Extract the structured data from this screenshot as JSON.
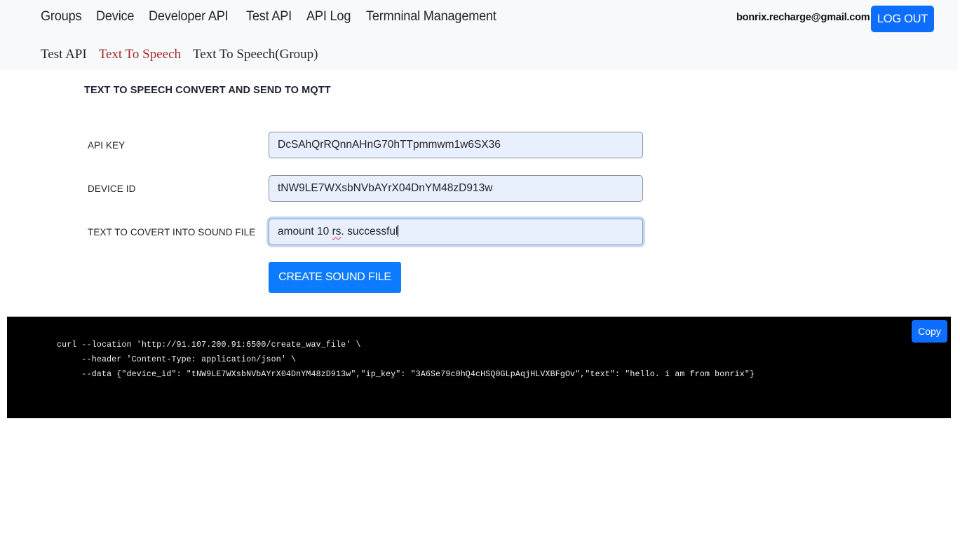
{
  "nav": {
    "main_items": [
      {
        "label": "Groups"
      },
      {
        "label": "Device"
      },
      {
        "label": "Developer API"
      },
      {
        "label": "Test API"
      },
      {
        "label": "API Log"
      },
      {
        "label": "Termninal Management"
      }
    ],
    "sub_items": [
      {
        "label": "Test API",
        "active": false
      },
      {
        "label": "Text To Speech",
        "active": true
      },
      {
        "label": "Text To Speech(Group)",
        "active": false
      }
    ],
    "user_email": "bonrix.recharge@gmail.com",
    "logout_label": "LOG OUT"
  },
  "page": {
    "title": "TEXT TO SPEECH CONVERT AND SEND TO MQTT"
  },
  "form": {
    "api_key": {
      "label": "API KEY",
      "value": "DcSAhQrRQnnAHnG70hTTpmmwm1w6SX36"
    },
    "device_id": {
      "label": "DEVICE ID",
      "value": "tNW9LE7WXsbNVbAYrX04DnYM48zD913w"
    },
    "text": {
      "label": "TEXT TO COVERT INTO SOUND FILE",
      "value_before": "amount 10 ",
      "value_misspelled": "rs",
      "value_after": ". successful"
    },
    "submit_label": "CREATE SOUND FILE"
  },
  "code": {
    "lines": [
      "curl --location 'http://91.107.200.91:6500/create_wav_file' \\",
      "     --header 'Content-Type: application/json' \\",
      "     --data {\"device_id\": \"tNW9LE7WXsbNVbAYrX04DnYM48zD913w\",\"ip_key\": \"3A6Se79c0hQ4cHSQ0GLpAqjHLVXBFgOv\",\"text\": \"hello. i am from bonrix\"}"
    ],
    "copy_label": "Copy"
  },
  "colors": {
    "accent": "#0d6efd",
    "active_subnav": "#a52a2a",
    "navbar_bg": "#f8f9fa",
    "input_bg": "#e8f0fe",
    "code_bg": "#000000"
  }
}
